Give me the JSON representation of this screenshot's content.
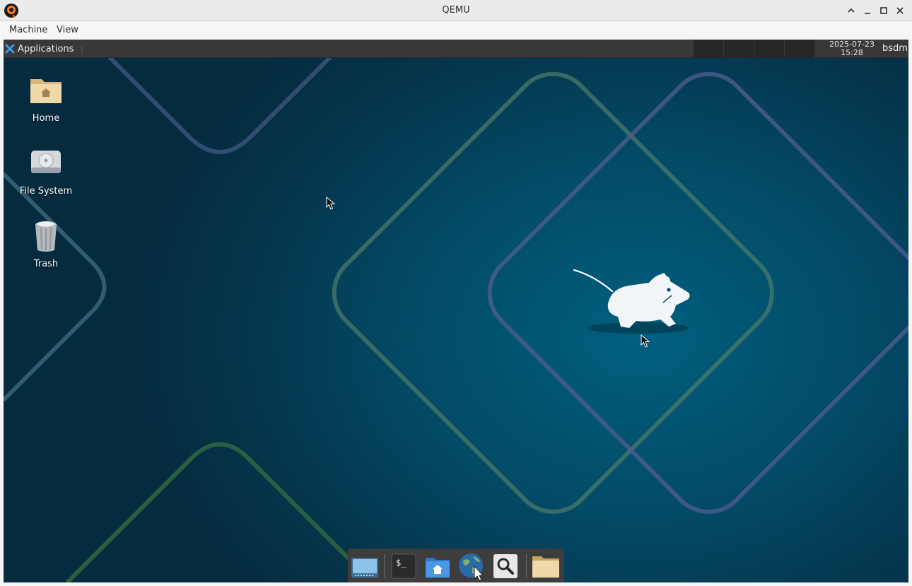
{
  "window": {
    "title": "QEMU",
    "logo_icon": "qemu-logo-icon",
    "controls": [
      "caret-up-icon",
      "minimize-icon",
      "maximize-icon",
      "close-icon"
    ]
  },
  "menubar": {
    "items": [
      "Machine",
      "View"
    ]
  },
  "panel": {
    "applications_label": "Applications",
    "grip": "⋮",
    "clock": {
      "date": "2025-07-23",
      "time": "15:28"
    },
    "user": "bsdm",
    "workspace_count": 4
  },
  "desktop": {
    "icons": [
      {
        "label": "Home",
        "icon": "home-folder-icon"
      },
      {
        "label": "File System",
        "icon": "hard-drive-icon"
      },
      {
        "label": "Trash",
        "icon": "trash-can-icon"
      }
    ],
    "wallpaper": "xfce-mouse-logo",
    "colors": {
      "wallpaper": "#00607f",
      "panel": "#383838"
    }
  },
  "dock": {
    "items": [
      "show-desktop-icon",
      "terminal-icon",
      "home-folder-icon",
      "web-browser-icon",
      "app-finder-icon",
      "folder-icon"
    ],
    "terminal_prompt": "$_"
  }
}
